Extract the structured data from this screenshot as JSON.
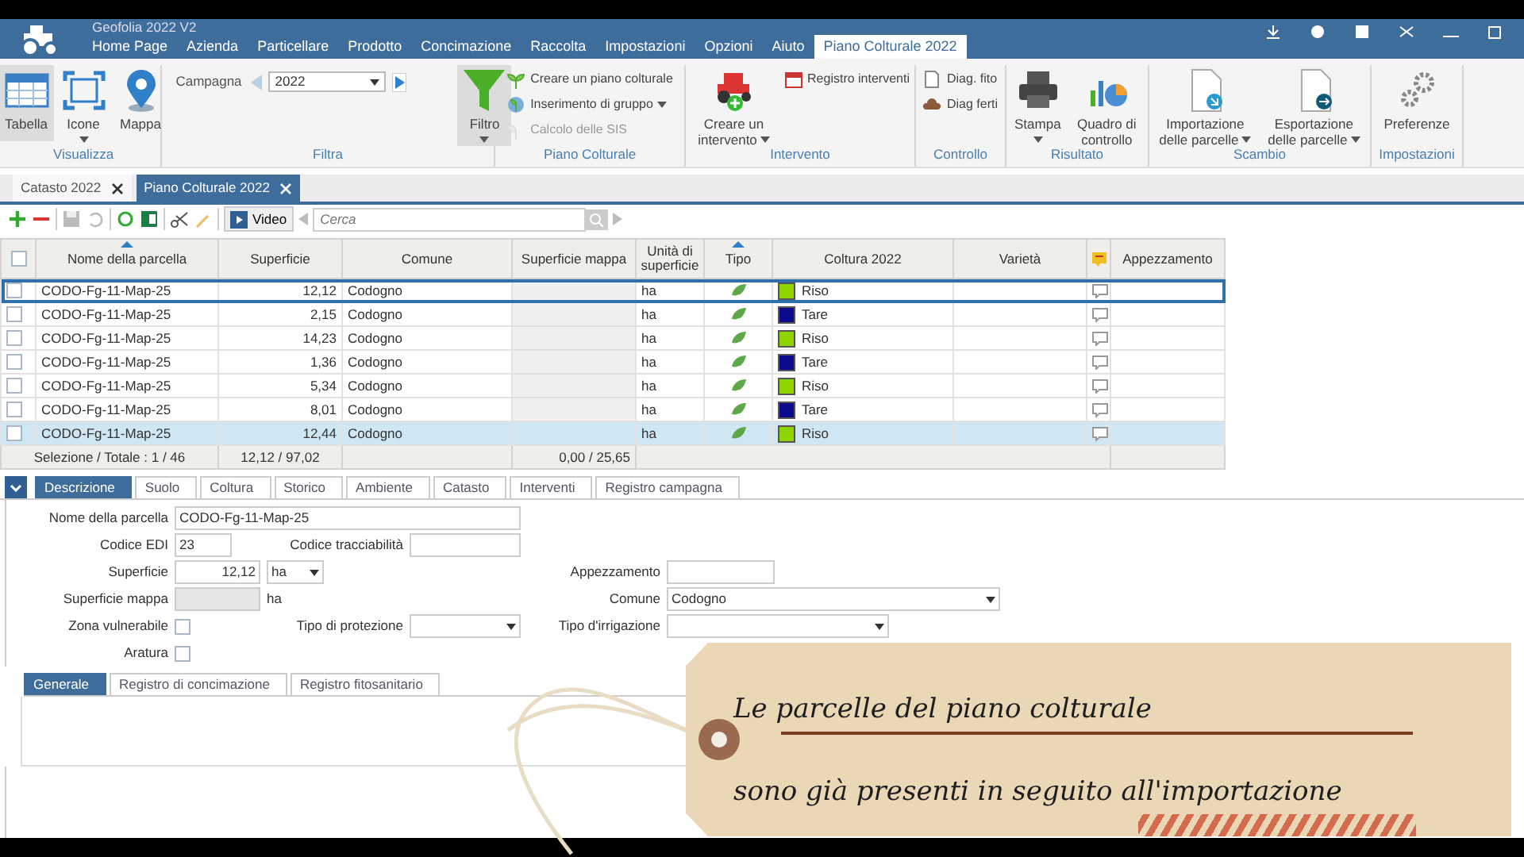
{
  "window": {
    "title": "Geofolia 2022 V2"
  },
  "menu": [
    {
      "label": "Home Page",
      "selected": false
    },
    {
      "label": "Azienda",
      "selected": false
    },
    {
      "label": "Particellare",
      "selected": false
    },
    {
      "label": "Prodotto",
      "selected": false
    },
    {
      "label": "Concimazione",
      "selected": false
    },
    {
      "label": "Raccolta",
      "selected": false
    },
    {
      "label": "Impostazioni",
      "selected": false
    },
    {
      "label": "Opzioni",
      "selected": false
    },
    {
      "label": "Aiuto",
      "selected": false
    },
    {
      "label": "Piano Colturale 2022",
      "selected": true
    }
  ],
  "ribbon": [
    {
      "label": "Visualizza",
      "items": [
        {
          "kind": "large",
          "label": "Tabella",
          "selected": true
        },
        {
          "kind": "large",
          "label": "Icone",
          "selected": false,
          "dropdown": true
        },
        {
          "kind": "large",
          "label": "Mappa",
          "selected": false
        }
      ]
    },
    {
      "label": "Filtra",
      "items": [
        {
          "kind": "picker",
          "label": "Campagna",
          "value": "2022"
        },
        {
          "kind": "large",
          "label": "Filtro",
          "selected": true,
          "dropdown": true
        }
      ]
    },
    {
      "label": "Piano Colturale",
      "items": [
        {
          "kind": "small",
          "label": "Creare un piano colturale"
        },
        {
          "kind": "small",
          "label": "Inserimento di gruppo",
          "dropdown": true
        },
        {
          "kind": "small",
          "label": "Calcolo delle SIS",
          "disabled": true
        }
      ]
    },
    {
      "label": "Intervento",
      "items": [
        {
          "kind": "large",
          "label": "Creare un intervento",
          "selected": false,
          "dropdown": true
        },
        {
          "kind": "small",
          "label": "Registro interventi"
        }
      ]
    },
    {
      "label": "Controllo",
      "items": [
        {
          "kind": "small",
          "label": "Diag. fito"
        },
        {
          "kind": "small",
          "label": "Diag ferti"
        }
      ]
    },
    {
      "label": "Risultato",
      "items": [
        {
          "kind": "large",
          "label": "Stampa",
          "selected": false,
          "dropdown": true
        },
        {
          "kind": "large",
          "label": "Quadro di controllo",
          "selected": false
        }
      ]
    },
    {
      "label": "Scambio",
      "items": [
        {
          "kind": "large",
          "label": "Importazione delle parcelle",
          "selected": false,
          "dropdown": true
        },
        {
          "kind": "large",
          "label": "Esportazione delle parcelle",
          "selected": false,
          "dropdown": true
        }
      ]
    },
    {
      "label": "Impostazioni",
      "items": [
        {
          "kind": "large",
          "label": "Preferenze",
          "selected": false
        }
      ]
    }
  ],
  "doc_tabs": [
    {
      "label": "Catasto 2022",
      "selected": false
    },
    {
      "label": "Piano Colturale 2022",
      "selected": true
    }
  ],
  "toolbar": {
    "video_button": "Video",
    "search": {
      "placeholder": "Cerca"
    }
  },
  "table": {
    "columns": [
      {
        "kind": "checkbox",
        "checked": false
      },
      {
        "label": "Nome della parcella",
        "sorted": true
      },
      {
        "label": "Superficie"
      },
      {
        "label": "Comune"
      },
      {
        "label": "Superficie mappa"
      },
      {
        "label": "Unità di superficie"
      },
      {
        "label": "Tipo",
        "sorted": true
      },
      {
        "label": "Coltura 2022"
      },
      {
        "label": "Varietà"
      },
      {
        "kind": "icon"
      },
      {
        "label": "Appezzamento"
      }
    ],
    "rows": [
      {
        "checked": false,
        "selected": false,
        "focused": true,
        "name": "CODO-Fg-11-Map-25",
        "superficie": "12,12",
        "comune": "Codogno",
        "unit": "ha",
        "crop": {
          "label": "Riso",
          "color": "#8fd400"
        }
      },
      {
        "checked": false,
        "selected": false,
        "focused": false,
        "name": "CODO-Fg-11-Map-25",
        "superficie": "2,15",
        "comune": "Codogno",
        "unit": "ha",
        "crop": {
          "label": "Tare",
          "color": "#0b0b8c"
        }
      },
      {
        "checked": false,
        "selected": false,
        "focused": false,
        "name": "CODO-Fg-11-Map-25",
        "superficie": "14,23",
        "comune": "Codogno",
        "unit": "ha",
        "crop": {
          "label": "Riso",
          "color": "#8fd400"
        }
      },
      {
        "checked": false,
        "selected": false,
        "focused": false,
        "name": "CODO-Fg-11-Map-25",
        "superficie": "1,36",
        "comune": "Codogno",
        "unit": "ha",
        "crop": {
          "label": "Tare",
          "color": "#0b0b8c"
        }
      },
      {
        "checked": false,
        "selected": false,
        "focused": false,
        "name": "CODO-Fg-11-Map-25",
        "superficie": "5,34",
        "comune": "Codogno",
        "unit": "ha",
        "crop": {
          "label": "Riso",
          "color": "#8fd400"
        }
      },
      {
        "checked": false,
        "selected": false,
        "focused": false,
        "name": "CODO-Fg-11-Map-25",
        "superficie": "8,01",
        "comune": "Codogno",
        "unit": "ha",
        "crop": {
          "label": "Tare",
          "color": "#0b0b8c"
        }
      },
      {
        "checked": false,
        "selected": true,
        "focused": false,
        "name": "CODO-Fg-11-Map-25",
        "superficie": "12,44",
        "comune": "Codogno",
        "unit": "ha",
        "crop": {
          "label": "Riso",
          "color": "#8fd400"
        }
      }
    ],
    "footer": {
      "selection": "Selezione / Totale : 1 / 46",
      "superficie": "12,12 / 97,02",
      "superficie_mappa": "0,00 / 25,65"
    }
  },
  "detail_tabs": [
    {
      "label": "Descrizione",
      "selected": true
    },
    {
      "label": "Suolo",
      "selected": false
    },
    {
      "label": "Coltura",
      "selected": false
    },
    {
      "label": "Storico",
      "selected": false
    },
    {
      "label": "Ambiente",
      "selected": false
    },
    {
      "label": "Catasto",
      "selected": false
    },
    {
      "label": "Interventi",
      "selected": false
    },
    {
      "label": "Registro campagna",
      "selected": false
    }
  ],
  "form": [
    {
      "kind": "text",
      "label": "Nome della parcella",
      "value": "CODO-Fg-11-Map-25"
    },
    {
      "kind": "text",
      "label": "Codice EDI",
      "value": "23"
    },
    {
      "kind": "text",
      "label": "Codice tracciabilità"
    },
    {
      "kind": "number",
      "label": "Superficie",
      "value": "12,12",
      "unit": "ha"
    },
    {
      "kind": "text",
      "label": "Appezzamento"
    },
    {
      "kind": "number",
      "label": "Superficie mappa",
      "disabled": true,
      "unit_text": "ha"
    },
    {
      "kind": "select",
      "label": "Comune",
      "value": "Codogno"
    },
    {
      "kind": "checkbox",
      "label": "Zona vulnerabile",
      "checked": false
    },
    {
      "kind": "select",
      "label": "Tipo di protezione"
    },
    {
      "kind": "select",
      "label": "Tipo d'irrigazione"
    },
    {
      "kind": "checkbox",
      "label": "Aratura",
      "checked": false
    }
  ],
  "sub_tabs": [
    {
      "label": "Generale",
      "selected": true
    },
    {
      "label": "Registro di concimazione",
      "selected": false
    },
    {
      "label": "Registro fitosanitario",
      "selected": false
    }
  ],
  "note": {
    "lines": [
      "Le parcelle del piano colturale",
      "sono già presenti in seguito all'importazione"
    ]
  }
}
